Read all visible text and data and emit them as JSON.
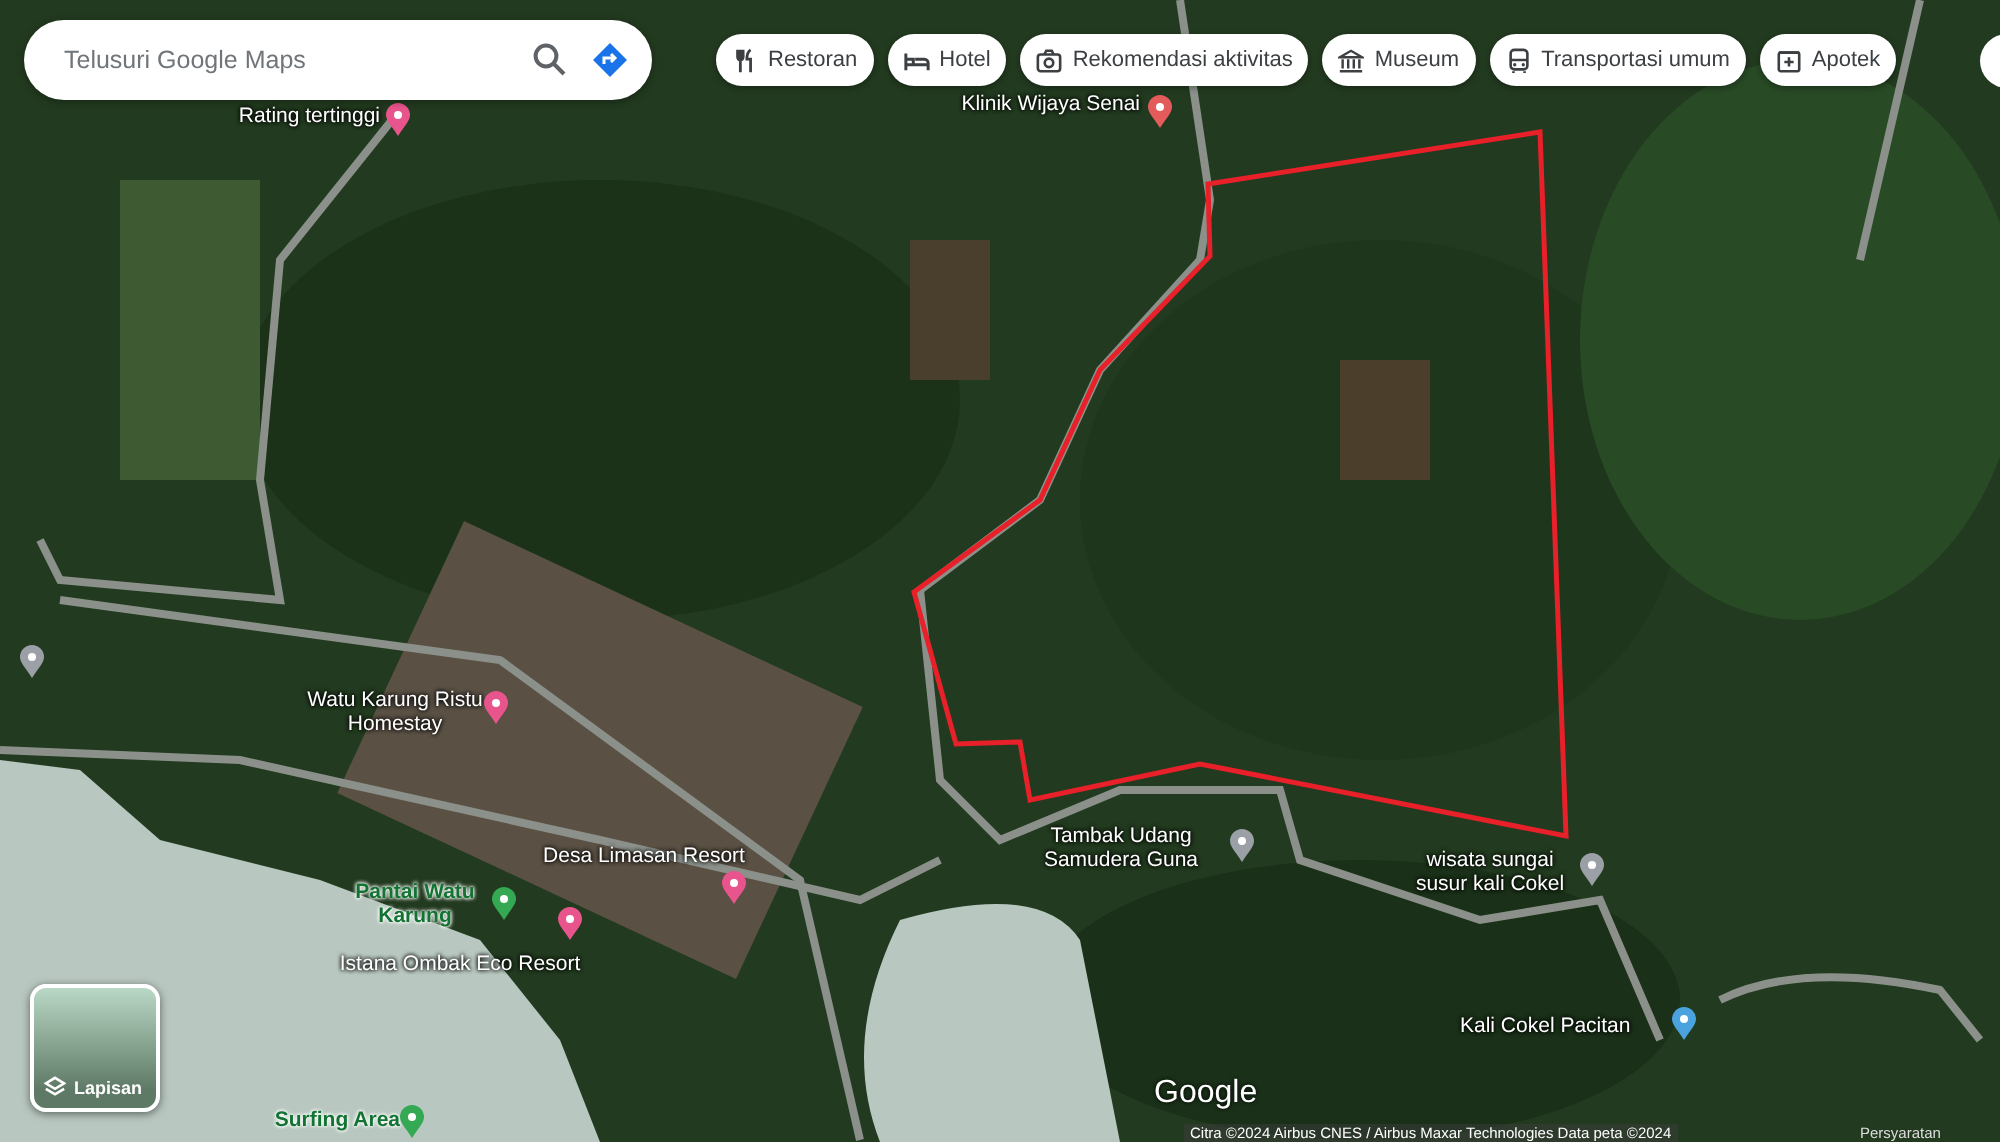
{
  "search": {
    "placeholder": "Telusuri Google Maps"
  },
  "categories": [
    {
      "label": "Restoran",
      "kind": "restaurant"
    },
    {
      "label": "Hotel",
      "kind": "hotel"
    },
    {
      "label": "Rekomendasi aktivitas",
      "kind": "camera"
    },
    {
      "label": "Museum",
      "kind": "museum"
    },
    {
      "label": "Transportasi umum",
      "kind": "transit"
    },
    {
      "label": "Apotek",
      "kind": "pharmacy"
    }
  ],
  "places": [
    {
      "name": "Rating tertinggi",
      "color": "#e8548c"
    },
    {
      "name": "Klinik Wijaya Senai",
      "color": "#e35b5b"
    },
    {
      "name": "Watu Karung Ristu Homestay",
      "color": "#e8548c"
    },
    {
      "name": "Desa Limasan Resort",
      "color": "#e8548c"
    },
    {
      "name": "Pantai Watu Karung",
      "color": "#34a853"
    },
    {
      "name": "Istana Ombak Eco Resort",
      "color": "#e8548c"
    },
    {
      "name": "Surfing Area",
      "color": "#34a853"
    },
    {
      "name": "Tambak Udang Samudera Guna",
      "color": "#9aa0a6"
    },
    {
      "name": "wisata sungai susur kali Cokel",
      "color": "#9aa0a6"
    },
    {
      "name": "Kali Cokel Pacitan",
      "color": "#4aa3df"
    }
  ],
  "layers_button": {
    "label": "Lapisan"
  },
  "logo": "Google",
  "attribution": "Citra ©2024 Airbus CNES / Airbus Maxar Technologies Data peta ©2024",
  "terms": "Persyaratan"
}
